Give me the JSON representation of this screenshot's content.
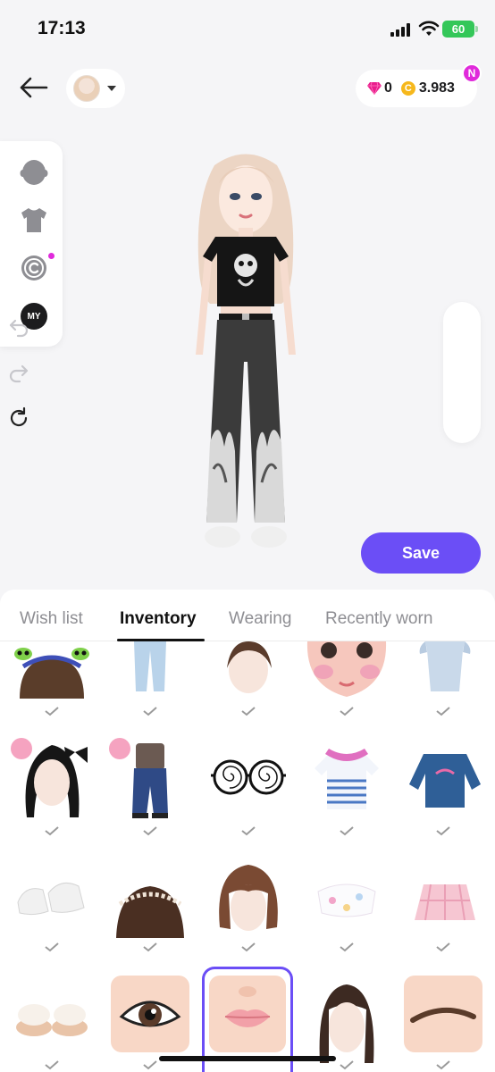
{
  "status_bar": {
    "time": "17:13",
    "battery": "60"
  },
  "header": {
    "gems": "0",
    "coins": "3.983",
    "notification_badge": "N",
    "coin_symbol": "C"
  },
  "categories": [
    {
      "icon": "head-icon"
    },
    {
      "icon": "tshirt-icon"
    },
    {
      "icon": "copyright-icon"
    },
    {
      "icon": "my-icon",
      "label": "MY"
    }
  ],
  "tools": [
    {
      "icon": "undo-icon"
    },
    {
      "icon": "redo-icon"
    },
    {
      "icon": "reset-icon"
    }
  ],
  "save_label": "Save",
  "tabs": [
    {
      "label": "Wish list",
      "active": false
    },
    {
      "label": "Inventory",
      "active": true
    },
    {
      "label": "Wearing",
      "active": false
    },
    {
      "label": "Recently worn",
      "active": false
    }
  ],
  "inventory_items": [
    [
      "alien-headband-hair",
      "light-jeans",
      "short-hair-bun",
      "pink-blush-face",
      "light-blue-dress"
    ],
    [
      "black-hair-bow",
      "denim-overalls-outfit",
      "spiral-glasses",
      "striped-tee-with-sweater",
      "blue-sweatshirt"
    ],
    [
      "white-sneakers",
      "pearl-headband-hair",
      "bob-hair-bangs",
      "floral-crop-top",
      "pink-plaid-skirt"
    ],
    [
      "fluffy-slippers",
      "brown-eyes",
      "pink-lips",
      "long-dark-hair",
      "brown-eyebrows"
    ]
  ],
  "colors": {
    "accent": "#6b4ef6",
    "badge": "#e02adb",
    "coin": "#f6b81c",
    "gem": "#e91e8c",
    "battery": "#34c759"
  }
}
